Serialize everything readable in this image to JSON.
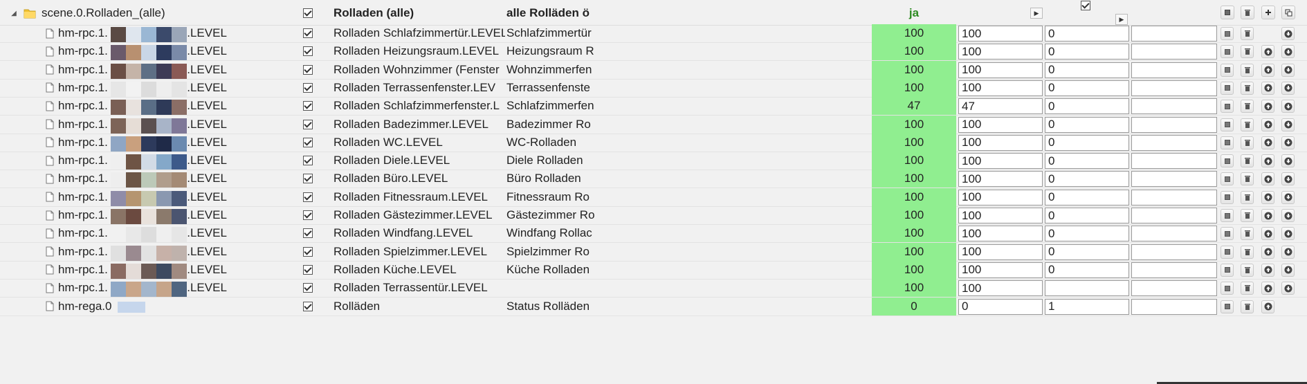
{
  "header": {
    "toggle": "◢",
    "id": "scene.0.Rolladen_(alle)",
    "name": "Rolladen (alle)",
    "desc": "alle Rolläden ö",
    "value": "ja"
  },
  "rows": [
    {
      "id": "hm-rpc.1.",
      "suffix": "3.LEVEL",
      "name": "Rolladen Schlafzimmertür.LEVEL",
      "desc": "Schlafzimmertür",
      "value": "100",
      "v1": "100",
      "v2": "0",
      "v3": "",
      "buttons": [
        "edit",
        "delete",
        "down"
      ]
    },
    {
      "id": "hm-rpc.1.",
      "suffix": "3.LEVEL",
      "name": "Rolladen Heizungsraum.LEVEL",
      "desc": "Heizungsraum R",
      "value": "100",
      "v1": "100",
      "v2": "0",
      "v3": "",
      "buttons": [
        "edit",
        "delete",
        "up",
        "down"
      ]
    },
    {
      "id": "hm-rpc.1.",
      "suffix": "3.LEVEL",
      "name": "Rolladen Wohnzimmer (Fenster",
      "desc": "Wohnzimmerfen",
      "value": "100",
      "v1": "100",
      "v2": "0",
      "v3": "",
      "buttons": [
        "edit",
        "delete",
        "up",
        "down"
      ]
    },
    {
      "id": "hm-rpc.1.",
      "suffix": "3.LEVEL",
      "name": "Rolladen Terrassenfenster.LEV",
      "desc": "Terrassenfenste",
      "value": "100",
      "v1": "100",
      "v2": "0",
      "v3": "",
      "buttons": [
        "edit",
        "delete",
        "up",
        "down"
      ]
    },
    {
      "id": "hm-rpc.1.",
      "suffix": "3.LEVEL",
      "name": "Rolladen Schlafzimmerfenster.L",
      "desc": "Schlafzimmerfen",
      "value": "47",
      "v1": "47",
      "v2": "0",
      "v3": "",
      "buttons": [
        "edit",
        "delete",
        "up",
        "down"
      ]
    },
    {
      "id": "hm-rpc.1.",
      "suffix": "3.LEVEL",
      "name": "Rolladen Badezimmer.LEVEL",
      "desc": "Badezimmer Ro",
      "value": "100",
      "v1": "100",
      "v2": "0",
      "v3": "",
      "buttons": [
        "edit",
        "delete",
        "up",
        "down"
      ]
    },
    {
      "id": "hm-rpc.1.",
      "suffix": "3.LEVEL",
      "name": "Rolladen WC.LEVEL",
      "desc": "WC-Rolladen",
      "value": "100",
      "v1": "100",
      "v2": "0",
      "v3": "",
      "buttons": [
        "edit",
        "delete",
        "up",
        "down"
      ]
    },
    {
      "id": "hm-rpc.1.",
      "suffix": "3.LEVEL",
      "name": "Rolladen Diele.LEVEL",
      "desc": "Diele Rolladen",
      "value": "100",
      "v1": "100",
      "v2": "0",
      "v3": "",
      "buttons": [
        "edit",
        "delete",
        "up",
        "down"
      ]
    },
    {
      "id": "hm-rpc.1.",
      "suffix": "3.LEVEL",
      "name": "Rolladen Büro.LEVEL",
      "desc": "Büro Rolladen",
      "value": "100",
      "v1": "100",
      "v2": "0",
      "v3": "",
      "buttons": [
        "edit",
        "delete",
        "up",
        "down"
      ]
    },
    {
      "id": "hm-rpc.1.",
      "suffix": "3.LEVEL",
      "name": "Rolladen Fitnessraum.LEVEL",
      "desc": "Fitnessraum Ro",
      "value": "100",
      "v1": "100",
      "v2": "0",
      "v3": "",
      "buttons": [
        "edit",
        "delete",
        "up",
        "down"
      ]
    },
    {
      "id": "hm-rpc.1.",
      "suffix": "3.LEVEL",
      "name": "Rolladen Gästezimmer.LEVEL",
      "desc": "Gästezimmer Ro",
      "value": "100",
      "v1": "100",
      "v2": "0",
      "v3": "",
      "buttons": [
        "edit",
        "delete",
        "up",
        "down"
      ]
    },
    {
      "id": "hm-rpc.1.",
      "suffix": "3.LEVEL",
      "name": "Rolladen Windfang.LEVEL",
      "desc": "Windfang Rollac",
      "value": "100",
      "v1": "100",
      "v2": "0",
      "v3": "",
      "buttons": [
        "edit",
        "delete",
        "up",
        "down"
      ]
    },
    {
      "id": "hm-rpc.1.",
      "suffix": "3.LEVEL",
      "name": "Rolladen Spielzimmer.LEVEL",
      "desc": "Spielzimmer Ro",
      "value": "100",
      "v1": "100",
      "v2": "0",
      "v3": "",
      "buttons": [
        "edit",
        "delete",
        "up",
        "down"
      ]
    },
    {
      "id": "hm-rpc.1.",
      "suffix": "3.LEVEL",
      "name": "Rolladen Küche.LEVEL",
      "desc": "Küche Rolladen",
      "value": "100",
      "v1": "100",
      "v2": "0",
      "v3": "",
      "buttons": [
        "edit",
        "delete",
        "up",
        "down"
      ]
    },
    {
      "id": "hm-rpc.1.",
      "suffix": "3.LEVEL",
      "name": "Rolladen Terrassentür.LEVEL",
      "desc": "",
      "value": "100",
      "v1": "100",
      "v2": "",
      "v3": "",
      "buttons": [
        "edit",
        "delete",
        "up",
        "down"
      ]
    },
    {
      "id": "hm-rega.0",
      "suffix": "",
      "name": "Rolläden",
      "desc": "Status Rolläden",
      "value": "0",
      "v1": "0",
      "v2": "1",
      "v3": "",
      "buttons": [
        "edit",
        "delete",
        "up"
      ]
    }
  ],
  "icons": {
    "folder": "folder-icon",
    "file": "file-icon",
    "edit": "edit-icon",
    "delete": "trash-icon",
    "up": "arrow-up-icon",
    "down": "arrow-down-icon",
    "add": "plus-icon",
    "copy": "copy-icon",
    "play": "play-icon"
  },
  "colors": {
    "value_bg": "#90ee90",
    "header_value": "#2e8b22"
  }
}
